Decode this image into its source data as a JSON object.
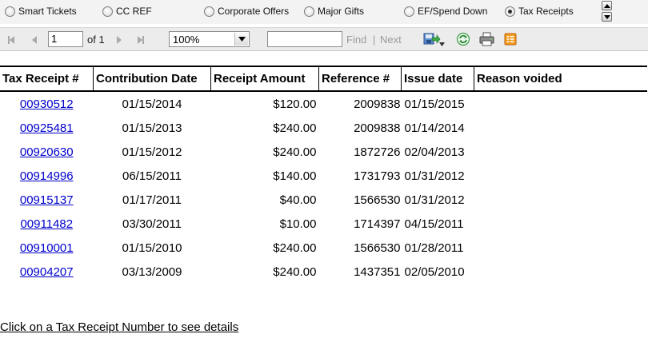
{
  "radio_options": [
    {
      "label": "Smart Tickets",
      "checked": false
    },
    {
      "label": "CC REF",
      "checked": false
    },
    {
      "label": "Corporate Offers",
      "checked": false
    },
    {
      "label": "Major Gifts",
      "checked": false
    },
    {
      "label": "EF/Spend Down",
      "checked": false
    },
    {
      "label": "Tax Receipts",
      "checked": true
    }
  ],
  "toolbar": {
    "page_value": "1",
    "of_label": "of 1",
    "zoom_value": "100%",
    "find_label": "Find",
    "separator": "|",
    "next_label": "Next",
    "icons": [
      "first-page-icon",
      "previous-page-icon",
      "next-page-icon",
      "last-page-icon",
      "export-icon",
      "refresh-icon",
      "print-icon",
      "data-feed-icon"
    ]
  },
  "table": {
    "columns": [
      "Tax Receipt #",
      "Contribution Date",
      "Receipt Amount",
      "Reference #",
      "Issue date",
      "Reason voided"
    ],
    "rows": [
      {
        "receipt": "00930512",
        "contribution_date": "01/15/2014",
        "amount": "$120.00",
        "reference": "2009838",
        "issue_date": "01/15/2015",
        "reason": ""
      },
      {
        "receipt": "00925481",
        "contribution_date": "01/15/2013",
        "amount": "$240.00",
        "reference": "2009838",
        "issue_date": "01/14/2014",
        "reason": ""
      },
      {
        "receipt": "00920630",
        "contribution_date": "01/15/2012",
        "amount": "$240.00",
        "reference": "1872726",
        "issue_date": "02/04/2013",
        "reason": ""
      },
      {
        "receipt": "00914996",
        "contribution_date": "06/15/2011",
        "amount": "$140.00",
        "reference": "1731793",
        "issue_date": "01/31/2012",
        "reason": ""
      },
      {
        "receipt": "00915137",
        "contribution_date": "01/17/2011",
        "amount": "$40.00",
        "reference": "1566530",
        "issue_date": "01/31/2012",
        "reason": ""
      },
      {
        "receipt": "00911482",
        "contribution_date": "03/30/2011",
        "amount": "$10.00",
        "reference": "1714397",
        "issue_date": "04/15/2011",
        "reason": ""
      },
      {
        "receipt": "00910001",
        "contribution_date": "01/15/2010",
        "amount": "$240.00",
        "reference": "1566530",
        "issue_date": "01/28/2011",
        "reason": ""
      },
      {
        "receipt": "00904207",
        "contribution_date": "03/13/2009",
        "amount": "$240.00",
        "reference": "1437351",
        "issue_date": "02/05/2010",
        "reason": ""
      }
    ]
  },
  "footer": {
    "link_text": "Click on a Tax Receipt Number to see details"
  },
  "colors": {
    "link": "#0000cc",
    "toolbar_bg": "#ececec",
    "radio_bar_bg": "#f3f3f3"
  }
}
